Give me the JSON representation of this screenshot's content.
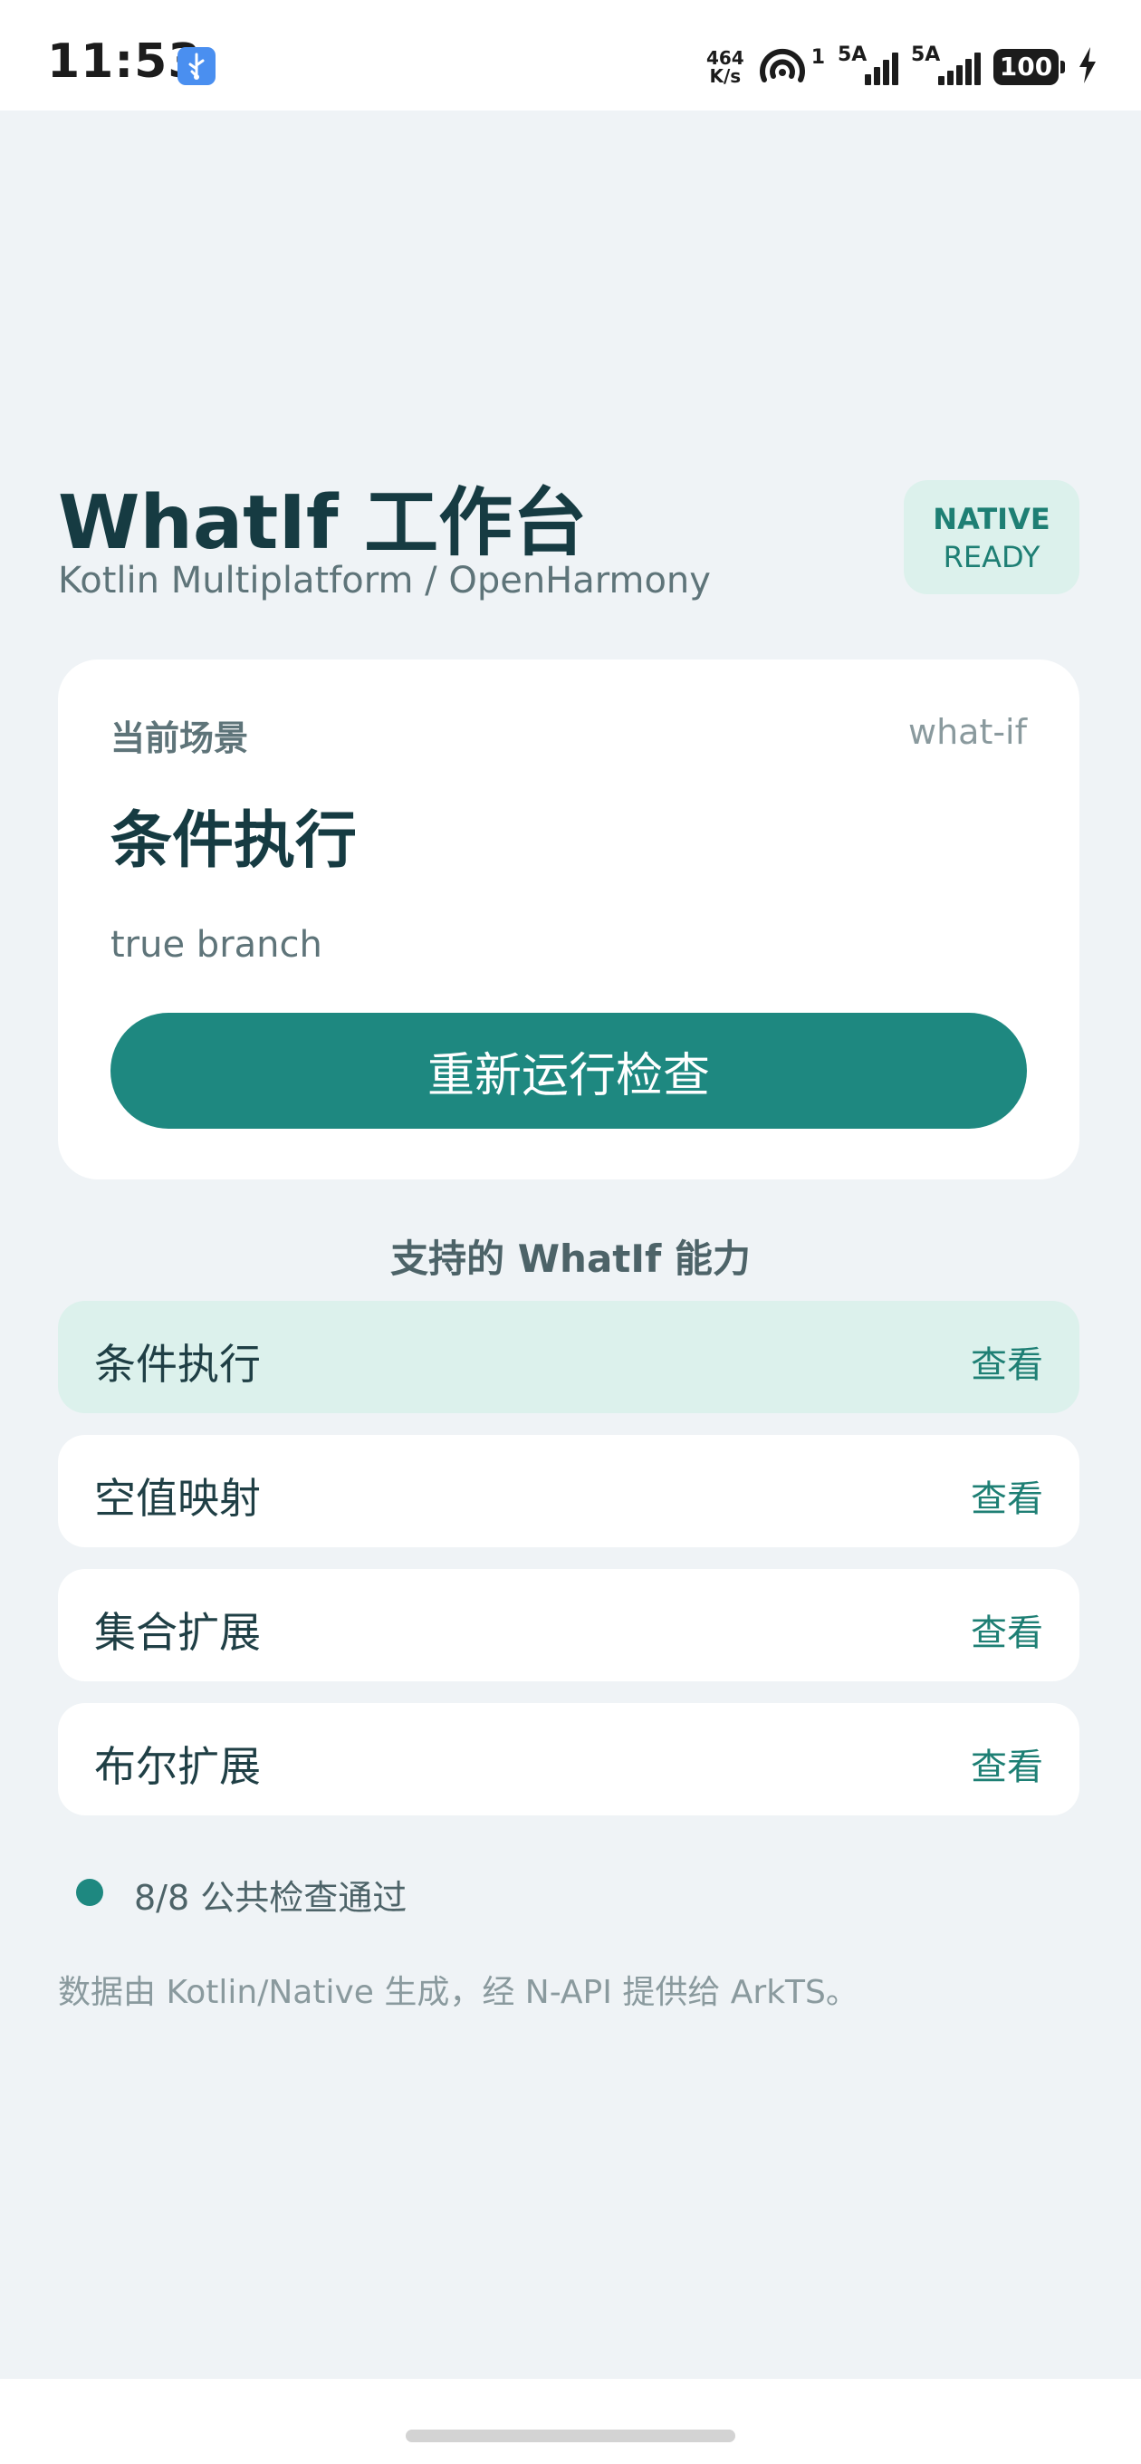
{
  "status_bar": {
    "time": "11:53",
    "net_speed_value": "464",
    "net_speed_unit": "K/s",
    "hotspot_count": "1",
    "sim1_type": "5A",
    "sim2_type": "5A",
    "battery_level": "100"
  },
  "header": {
    "title": "WhatIf 工作台",
    "subtitle": "Kotlin Multiplatform / OpenHarmony",
    "badge_line1": "NATIVE",
    "badge_line2": "READY"
  },
  "scenario": {
    "label": "当前场景",
    "tag": "what-if",
    "title": "条件执行",
    "result": "true branch",
    "rerun_label": "重新运行检查"
  },
  "capabilities": {
    "heading": "支持的 WhatIf 能力",
    "items": [
      {
        "name": "条件执行",
        "action": "查看"
      },
      {
        "name": "空值映射",
        "action": "查看"
      },
      {
        "name": "集合扩展",
        "action": "查看"
      },
      {
        "name": "布尔扩展",
        "action": "查看"
      }
    ]
  },
  "status": {
    "check_summary": "8/8 公共检查通过",
    "footer_note": "数据由 Kotlin/Native 生成，经 N-API 提供给 ArkTS。"
  },
  "colors": {
    "accent": "#1e8880",
    "accent_soft": "#dcf1ec",
    "background": "#eff3f6",
    "title_text": "#163b42"
  }
}
